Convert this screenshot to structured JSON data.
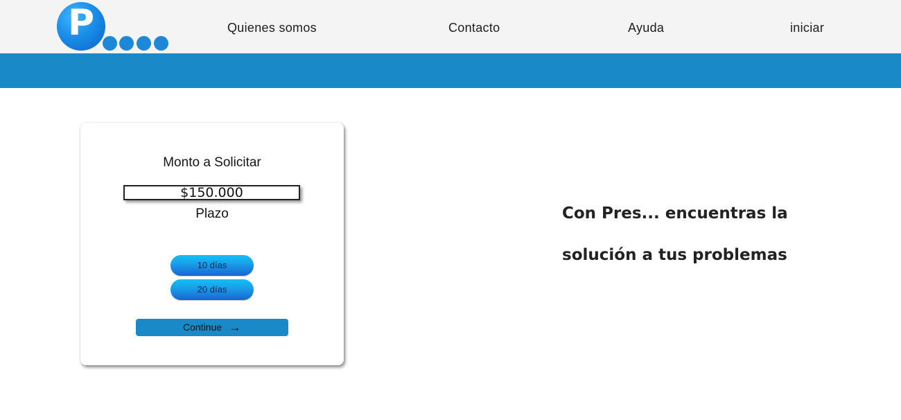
{
  "header": {
    "logo_letter": "P",
    "nav": [
      {
        "label": "Quienes somos"
      },
      {
        "label": "Contacto"
      },
      {
        "label": "Ayuda"
      },
      {
        "label": "iniciar"
      }
    ]
  },
  "colors": {
    "header_bg": "#f4f4f4",
    "brand_blue": "#1a89c8",
    "button_gradient_top": "#0fc0f6",
    "button_gradient_bottom": "#1766d2"
  },
  "form": {
    "title": "Monto a Solicitar",
    "amount_value": "$150.000",
    "term_label": "Plazo",
    "term_options": [
      "10 días",
      "20 días"
    ],
    "continue_label": "Continue",
    "continue_icon": "arrow-right-icon"
  },
  "tagline": {
    "line1": "Con Pres... encuentras la",
    "line2": "solución a tus problemas"
  }
}
